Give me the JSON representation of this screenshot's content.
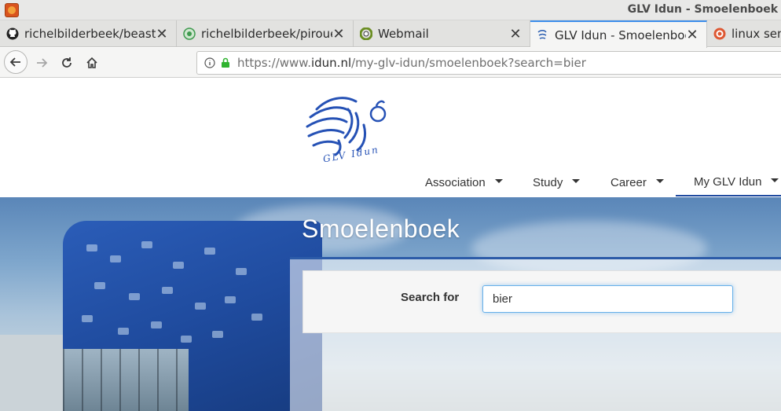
{
  "window": {
    "title": "GLV Idun - Smoelenboek"
  },
  "tabs": [
    {
      "label": "richelbilderbeek/beastie",
      "icon": "github-icon"
    },
    {
      "label": "richelbilderbeek/pirouet",
      "icon": "pirouette-icon"
    },
    {
      "label": "Webmail",
      "icon": "webmail-icon"
    },
    {
      "label": "GLV Idun - Smoelenboek",
      "icon": "idun-icon",
      "active": true
    },
    {
      "label": "linux send",
      "icon": "duckduckgo-icon"
    }
  ],
  "navbar": {
    "url_prefix": "https://www.",
    "url_host": "idun.nl",
    "url_path": "/my-glv-idun/smoelenboek?search=bier"
  },
  "logo": {
    "text": "GLV Idun"
  },
  "menu": [
    {
      "label": "Association"
    },
    {
      "label": "Study"
    },
    {
      "label": "Career"
    },
    {
      "label": "My GLV Idun",
      "active": true
    }
  ],
  "hero": {
    "title": "Smoelenboek"
  },
  "search": {
    "label": "Search for",
    "value": "bier"
  },
  "colors": {
    "accent": "#1f4aa0",
    "tab_active": "#3d8eeb",
    "focus": "#66afe9"
  }
}
